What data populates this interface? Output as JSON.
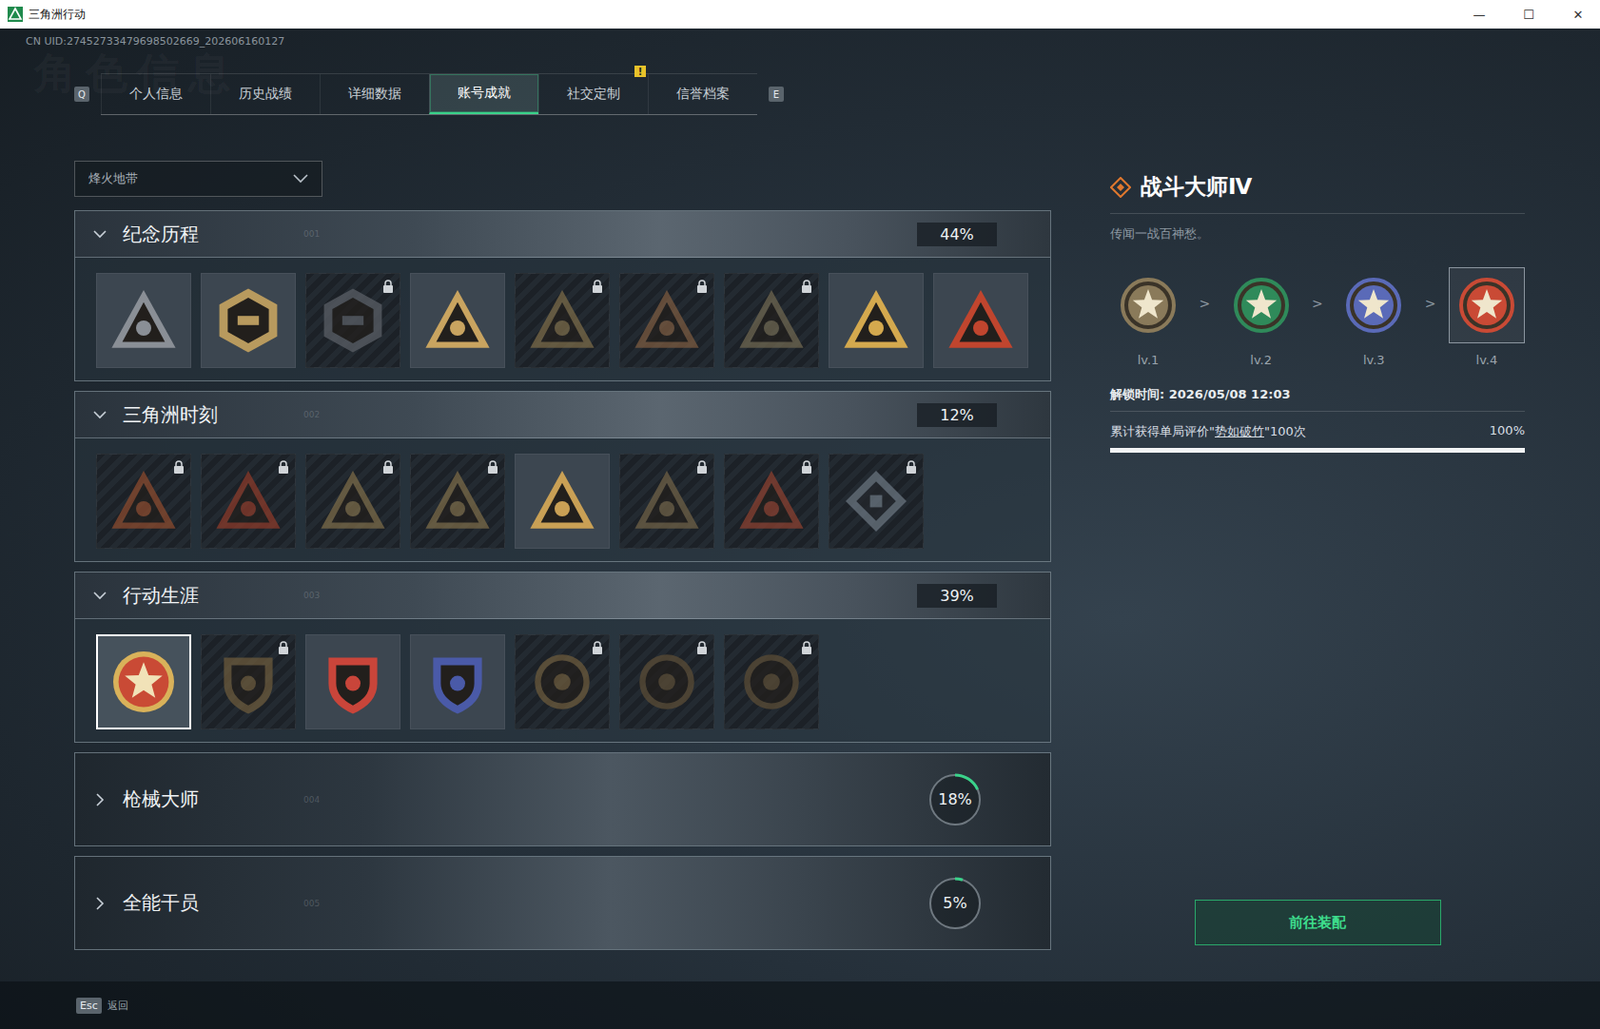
{
  "window": {
    "title": "三角洲行动",
    "controls": [
      "—",
      "☐",
      "✕"
    ]
  },
  "uid": "CN UID:27452733479698502669_202606160127",
  "watermark": "角色信息",
  "tabs": {
    "prevKey": "Q",
    "nextKey": "E",
    "items": [
      {
        "label": "个人信息",
        "selected": false,
        "alert": null
      },
      {
        "label": "历史战绩",
        "selected": false,
        "alert": null
      },
      {
        "label": "详细数据",
        "selected": false,
        "alert": null
      },
      {
        "label": "账号成就",
        "selected": true,
        "alert": null
      },
      {
        "label": "社交定制",
        "selected": false,
        "alert": "!"
      },
      {
        "label": "信誉档案",
        "selected": false,
        "alert": null
      }
    ]
  },
  "mode_select": {
    "value": "烽火地带",
    "open": false
  },
  "sections": [
    {
      "title": "纪念历程",
      "code": "001",
      "percent": "44%",
      "level": 0.44,
      "expanded": true,
      "badges": [
        {
          "kind": "triangle",
          "color": "#8a8f96",
          "locked": false,
          "selected": false
        },
        {
          "kind": "hexagon",
          "color": "#b89a5e",
          "locked": false,
          "selected": false
        },
        {
          "kind": "hexagon",
          "color": "#5a5f66",
          "locked": true,
          "selected": false
        },
        {
          "kind": "triangle",
          "color": "#c9a460",
          "locked": false,
          "selected": false
        },
        {
          "kind": "triangle",
          "color": "#7a6a48",
          "locked": true,
          "selected": false
        },
        {
          "kind": "triangle",
          "color": "#7a5a40",
          "locked": true,
          "selected": false
        },
        {
          "kind": "triangle",
          "color": "#6e6650",
          "locked": true,
          "selected": false
        },
        {
          "kind": "triangle",
          "color": "#d4a94e",
          "locked": false,
          "selected": false
        },
        {
          "kind": "triangle",
          "color": "#c0452e",
          "locked": false,
          "selected": false
        }
      ]
    },
    {
      "title": "三角洲时刻",
      "code": "002",
      "percent": "12%",
      "level": 0.12,
      "expanded": true,
      "badges": [
        {
          "kind": "triangle",
          "color": "#8a4a2e",
          "locked": true,
          "selected": false
        },
        {
          "kind": "triangle",
          "color": "#8a3a2a",
          "locked": true,
          "selected": false
        },
        {
          "kind": "triangle",
          "color": "#7a6a48",
          "locked": true,
          "selected": false
        },
        {
          "kind": "triangle",
          "color": "#7a6a48",
          "locked": true,
          "selected": false
        },
        {
          "kind": "triangle",
          "color": "#c9a055",
          "locked": false,
          "selected": false
        },
        {
          "kind": "triangle",
          "color": "#6e6046",
          "locked": true,
          "selected": false
        },
        {
          "kind": "triangle",
          "color": "#8a4030",
          "locked": true,
          "selected": false
        },
        {
          "kind": "diamond",
          "color": "#6a7580",
          "locked": true,
          "selected": false
        }
      ]
    },
    {
      "title": "行动生涯",
      "code": "003",
      "percent": "39%",
      "level": 0.39,
      "expanded": true,
      "badges": [
        {
          "kind": "medal",
          "color": "#c94a35",
          "locked": false,
          "selected": true
        },
        {
          "kind": "shield",
          "color": "#6b5a3c",
          "locked": true,
          "selected": false
        },
        {
          "kind": "shield",
          "color": "#c9453a",
          "locked": false,
          "selected": false
        },
        {
          "kind": "shield",
          "color": "#4a5aa8",
          "locked": false,
          "selected": false
        },
        {
          "kind": "round",
          "color": "#6b5a3c",
          "locked": true,
          "selected": false
        },
        {
          "kind": "round",
          "color": "#5a4c36",
          "locked": true,
          "selected": false
        },
        {
          "kind": "round",
          "color": "#5a4c36",
          "locked": true,
          "selected": false
        }
      ]
    },
    {
      "title": "枪械大师",
      "code": "004",
      "percent": "18%",
      "level": 0.18,
      "expanded": false,
      "badges": []
    },
    {
      "title": "全能干员",
      "code": "005",
      "percent": "5%",
      "level": 0.05,
      "expanded": false,
      "badges": []
    }
  ],
  "detail": {
    "title": "战斗大师Ⅳ",
    "subtitle": "传闻一战百神愁。",
    "separator": ">",
    "levels": [
      {
        "label": "lv.1",
        "color": "#8a7a5a",
        "selected": false
      },
      {
        "label": "lv.2",
        "color": "#2f8a5a",
        "selected": false
      },
      {
        "label": "lv.3",
        "color": "#5a6ab8",
        "selected": false
      },
      {
        "label": "lv.4",
        "color": "#c94a35",
        "selected": true
      }
    ],
    "unlock": "解锁时间: 2026/05/08 12:03",
    "task": {
      "prefix": "累计获得单局评价\"",
      "highlight": "势如破竹",
      "suffix": "\"100次",
      "percent": "100%",
      "level": 1
    },
    "button": "前往装配"
  },
  "footer": {
    "key": "Esc",
    "label": "返回"
  }
}
